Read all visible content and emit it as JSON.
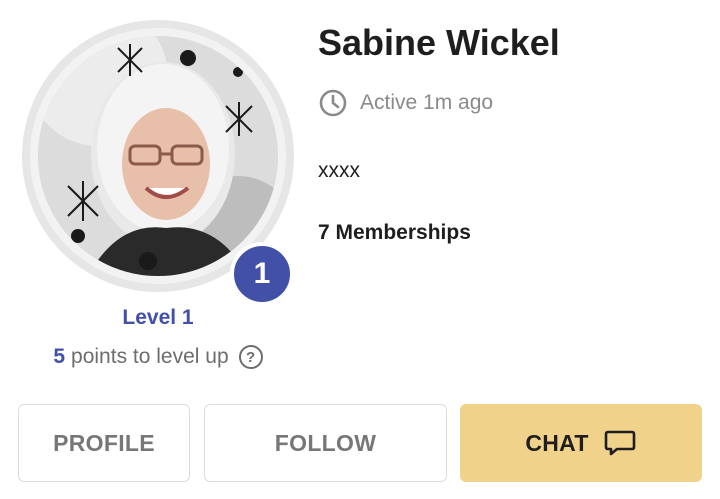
{
  "profile": {
    "name": "Sabine Wickel",
    "active_status": "Active 1m ago",
    "tagline": "xxxx",
    "memberships": "7 Memberships",
    "level_badge": "1",
    "level_label": "Level 1",
    "points_value": "5",
    "points_text": "points to level up",
    "help_glyph": "?"
  },
  "buttons": {
    "profile_label": "PROFILE",
    "follow_label": "FOLLOW",
    "chat_label": "CHAT"
  },
  "icons": {
    "clock": "clock-icon",
    "help": "help-circle-icon",
    "chat": "chat-bubble-icon"
  },
  "colors": {
    "accent": "#4350a8",
    "chat_button": "#f1d28a",
    "muted_text": "#8a8a8a"
  }
}
